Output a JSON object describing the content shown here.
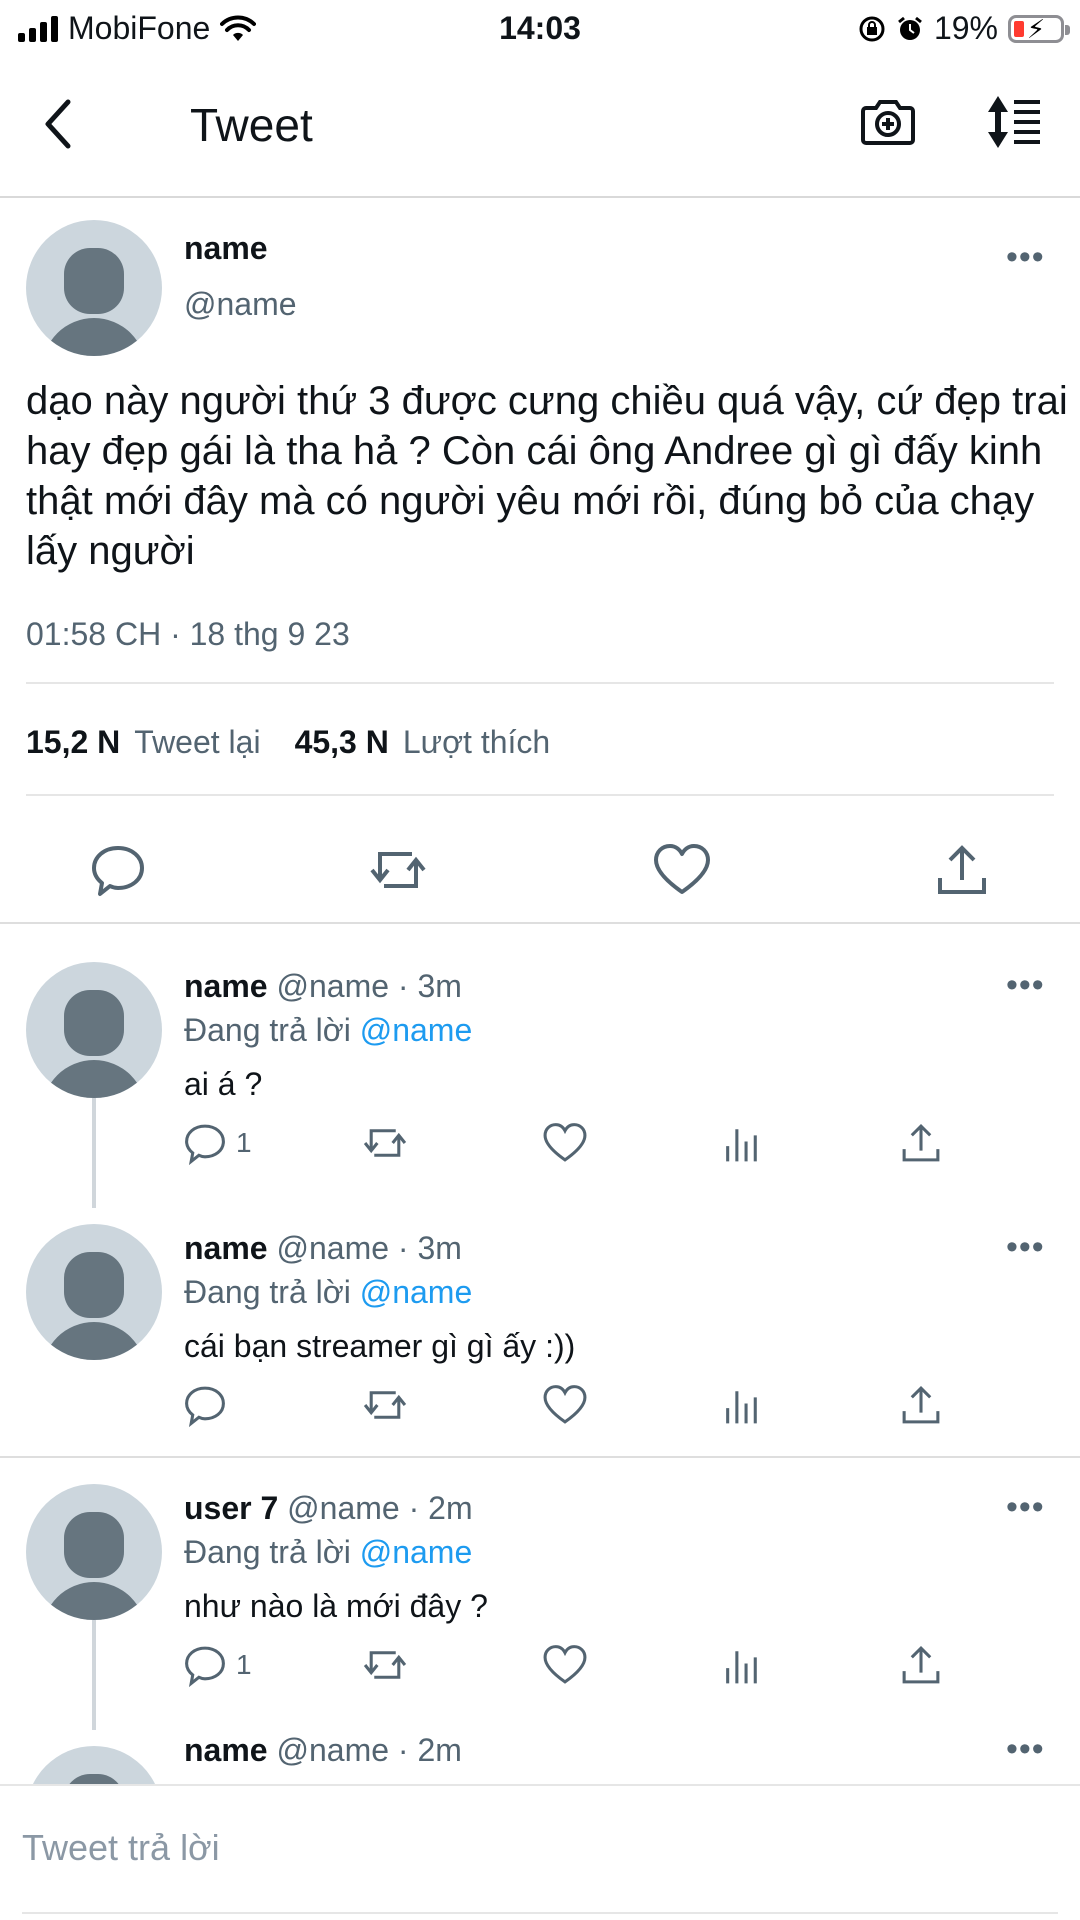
{
  "status_bar": {
    "carrier": "MobiFone",
    "time": "14:03",
    "battery": "19%",
    "icons": [
      "signal-icon",
      "wifi-icon",
      "orientation-lock-icon",
      "alarm-icon",
      "battery-icon"
    ]
  },
  "header": {
    "title": "Tweet",
    "icons": [
      "back-icon",
      "camera-plus-icon",
      "sort-icon"
    ]
  },
  "main_tweet": {
    "name": "name",
    "handle": "@name",
    "text": "dạo này người thứ 3 được cưng chiều quá vậy, cứ đẹp trai hay đẹp gái là tha hả ? Còn cái ông Andree gì gì đấy kinh thật mới đây mà có người yêu mới rồi, đúng bỏ của chạy lấy người",
    "timestamp": "01:58 CH · 18 thg 9 23",
    "retweets_count": "15,2 N",
    "retweets_label": "Tweet lại",
    "likes_count": "45,3 N",
    "likes_label": "Lượt thích",
    "more": "•••"
  },
  "replies": [
    {
      "name": "name",
      "handle_time": "@name · 3m",
      "replying_label": "Đang trả lời",
      "mention": "@name",
      "text": "ai á ?",
      "reply_count": "1",
      "more": "•••"
    },
    {
      "name": "name",
      "handle_time": "@name · 3m",
      "replying_label": "Đang trả lời",
      "mention": "@name",
      "text": "cái bạn streamer gì gì ấy :))",
      "reply_count": "",
      "more": "•••"
    },
    {
      "name": "user 7",
      "handle_time": "@name · 2m",
      "replying_label": "Đang trả lời",
      "mention": "@name",
      "text": "như nào là mới đây ?",
      "reply_count": "1",
      "more": "•••"
    },
    {
      "name": "name",
      "handle_time": "@name · 2m",
      "more": "•••"
    }
  ],
  "composer": {
    "placeholder": "Tweet trả lời"
  }
}
